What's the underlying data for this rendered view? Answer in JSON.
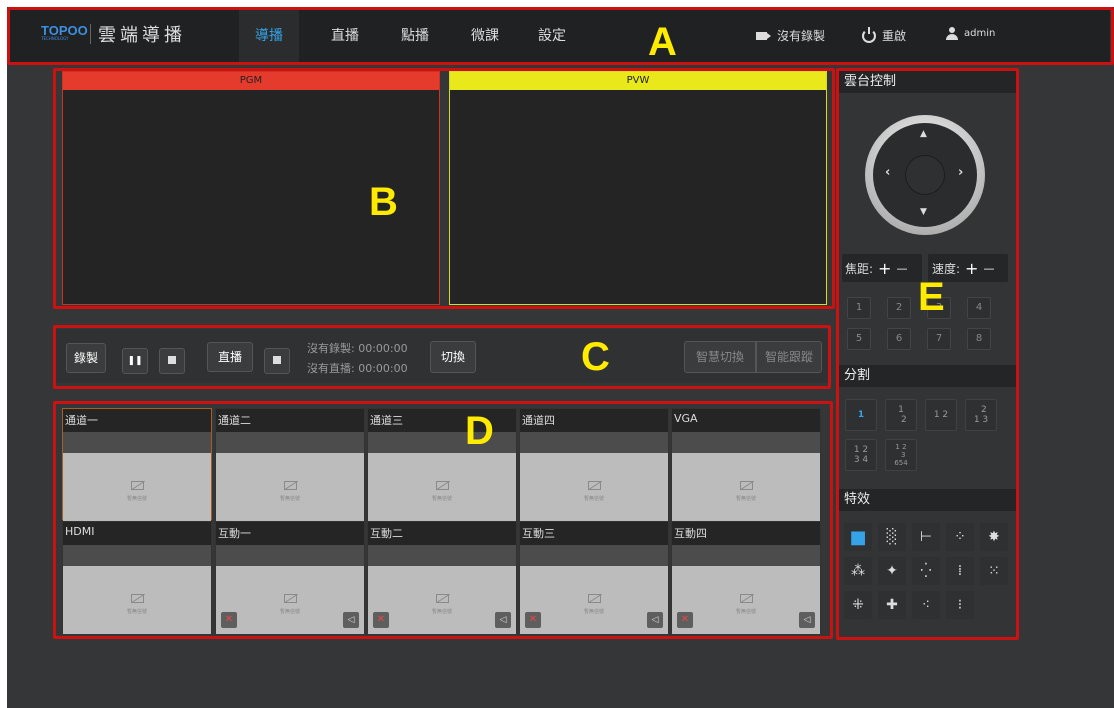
{
  "header": {
    "logo_text": "TOPOO",
    "logo_sub": "TECHNOLOGY",
    "brand": "雲端導播",
    "nav": [
      {
        "label": "導播",
        "active": true
      },
      {
        "label": "直播"
      },
      {
        "label": "點播"
      },
      {
        "label": "微課"
      },
      {
        "label": "設定"
      }
    ],
    "record_status": "沒有錄製",
    "restart": "重啟",
    "user": "admin"
  },
  "monitors": {
    "pgm": "PGM",
    "pvw": "PVW"
  },
  "controls": {
    "record": "錄製",
    "pause": "❚❚",
    "live": "直播",
    "switch": "切換",
    "record_status": "沒有錄製: 00:00:00",
    "live_status": "沒有直播: 00:00:00",
    "smart_switch": "智慧切換",
    "smart_track": "智能跟蹤"
  },
  "channels": [
    {
      "name": "通道一"
    },
    {
      "name": "通道二"
    },
    {
      "name": "通道三"
    },
    {
      "name": "通道四"
    },
    {
      "name": "VGA"
    },
    {
      "name": "HDMI"
    },
    {
      "name": "互動一"
    },
    {
      "name": "互動二"
    },
    {
      "name": "互動三"
    },
    {
      "name": "互動四"
    }
  ],
  "no_signal": "暫無信號",
  "panel": {
    "ptz_title": "雲台控制",
    "focus": "焦距:",
    "speed": "速度:",
    "plus": "+",
    "minus": "—",
    "presets": [
      "1",
      "2",
      "3",
      "4",
      "5",
      "6",
      "7",
      "8"
    ],
    "split_title": "分割",
    "effects_title": "特效"
  },
  "zones": [
    "A",
    "B",
    "C",
    "D",
    "E"
  ],
  "accent": "#35a3e8"
}
